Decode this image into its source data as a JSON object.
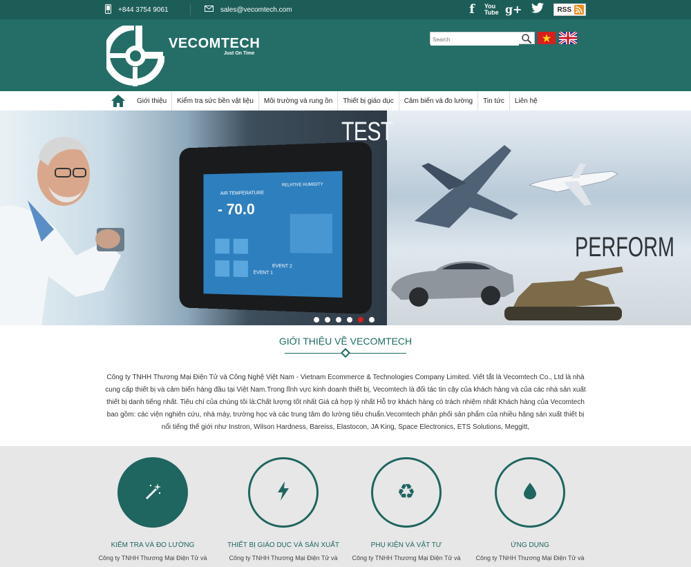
{
  "topbar": {
    "phone": "+844 3754 9061",
    "email": "sales@vecomtech.com",
    "social": [
      "facebook-icon",
      "youtube-icon",
      "google-plus-icon",
      "twitter-icon"
    ],
    "youtube_label": "You Tube",
    "rss_label": "RSS"
  },
  "header": {
    "brand": "VECOMTECH",
    "tagline": "Just On Time",
    "search_placeholder": "Search"
  },
  "nav": {
    "items": [
      "Giới thiệu",
      "Kiểm tra sức bền vật liệu",
      "Môi trường và rung ồn",
      "Thiết bị giáo dục",
      "Cảm biến và đo lường",
      "Tin tức",
      "Liên hệ"
    ]
  },
  "slider": {
    "headline_1": "TEST",
    "headline_2": "PERFORM",
    "screen": {
      "air_temp_label": "AIR TEMPERATURE",
      "air_temp_value": "- 70.0",
      "humidity_label": "RELATIVE HUMIDITY",
      "event_1": "EVENT 1",
      "event_2": "EVENT 2"
    },
    "slide_count": 6,
    "active_slide": 5
  },
  "about": {
    "title": "GIỚI THIỆU VỀ VECOMTECH",
    "text": "Công ty TNHH Thương Mại Điện Tử và Công Nghệ Việt Nam - Vietnam Ecommerce & Technologies Company Limited. Viết tắt là Vecomtech Co., Ltd là nhà cung cấp thiết bị và cảm biến hàng đầu tại Việt Nam.Trong lĩnh vực kinh doanh thiết bị, Vecomtech là đối tác tin cậy của khách hàng và của các nhà sản xuất thiết bị danh tiếng nhất. Tiêu chí của chúng tôi là:Chất lượng tốt nhất Giá cả hợp lý nhất Hỗ trợ khách hàng có trách nhiệm nhất Khách hàng của Vecomtech bao gồm: các viện nghiên cứu, nhà máy, trường học và các trung tâm đo lường tiêu chuẩn.Vecomtech phân phối sản phẩm của nhiều hãng sản xuất thiết bị nổi tiếng thế giới như Instron, Wilson Hardness, Bareiss, Elastocon, JA King, Space Electronics, ETS Solutions, Meggitt,"
  },
  "services": [
    {
      "title": "KIỂM TRA VÀ ĐO LƯỜNG",
      "desc": "Công ty TNHH Thương Mại Điện Tử và",
      "icon": "magic-wand-icon"
    },
    {
      "title": "THIẾT BỊ GIÁO DỤC VÀ SẢN XUẤT",
      "desc": "Công ty TNHH Thương Mại Điện Tử và",
      "icon": "lightning-icon"
    },
    {
      "title": "PHỤ KIỆN VÀ VẬT TƯ",
      "desc": "Công ty TNHH Thương Mại Điện Tử và",
      "icon": "recycle-icon"
    },
    {
      "title": "ỨNG DỤNG",
      "desc": "Công ty TNHH Thương Mại Điện Tử và",
      "icon": "drop-icon"
    }
  ],
  "colors": {
    "primary": "#256e68",
    "topbar": "#1c5d58",
    "active_dot": "#e21b1b"
  }
}
